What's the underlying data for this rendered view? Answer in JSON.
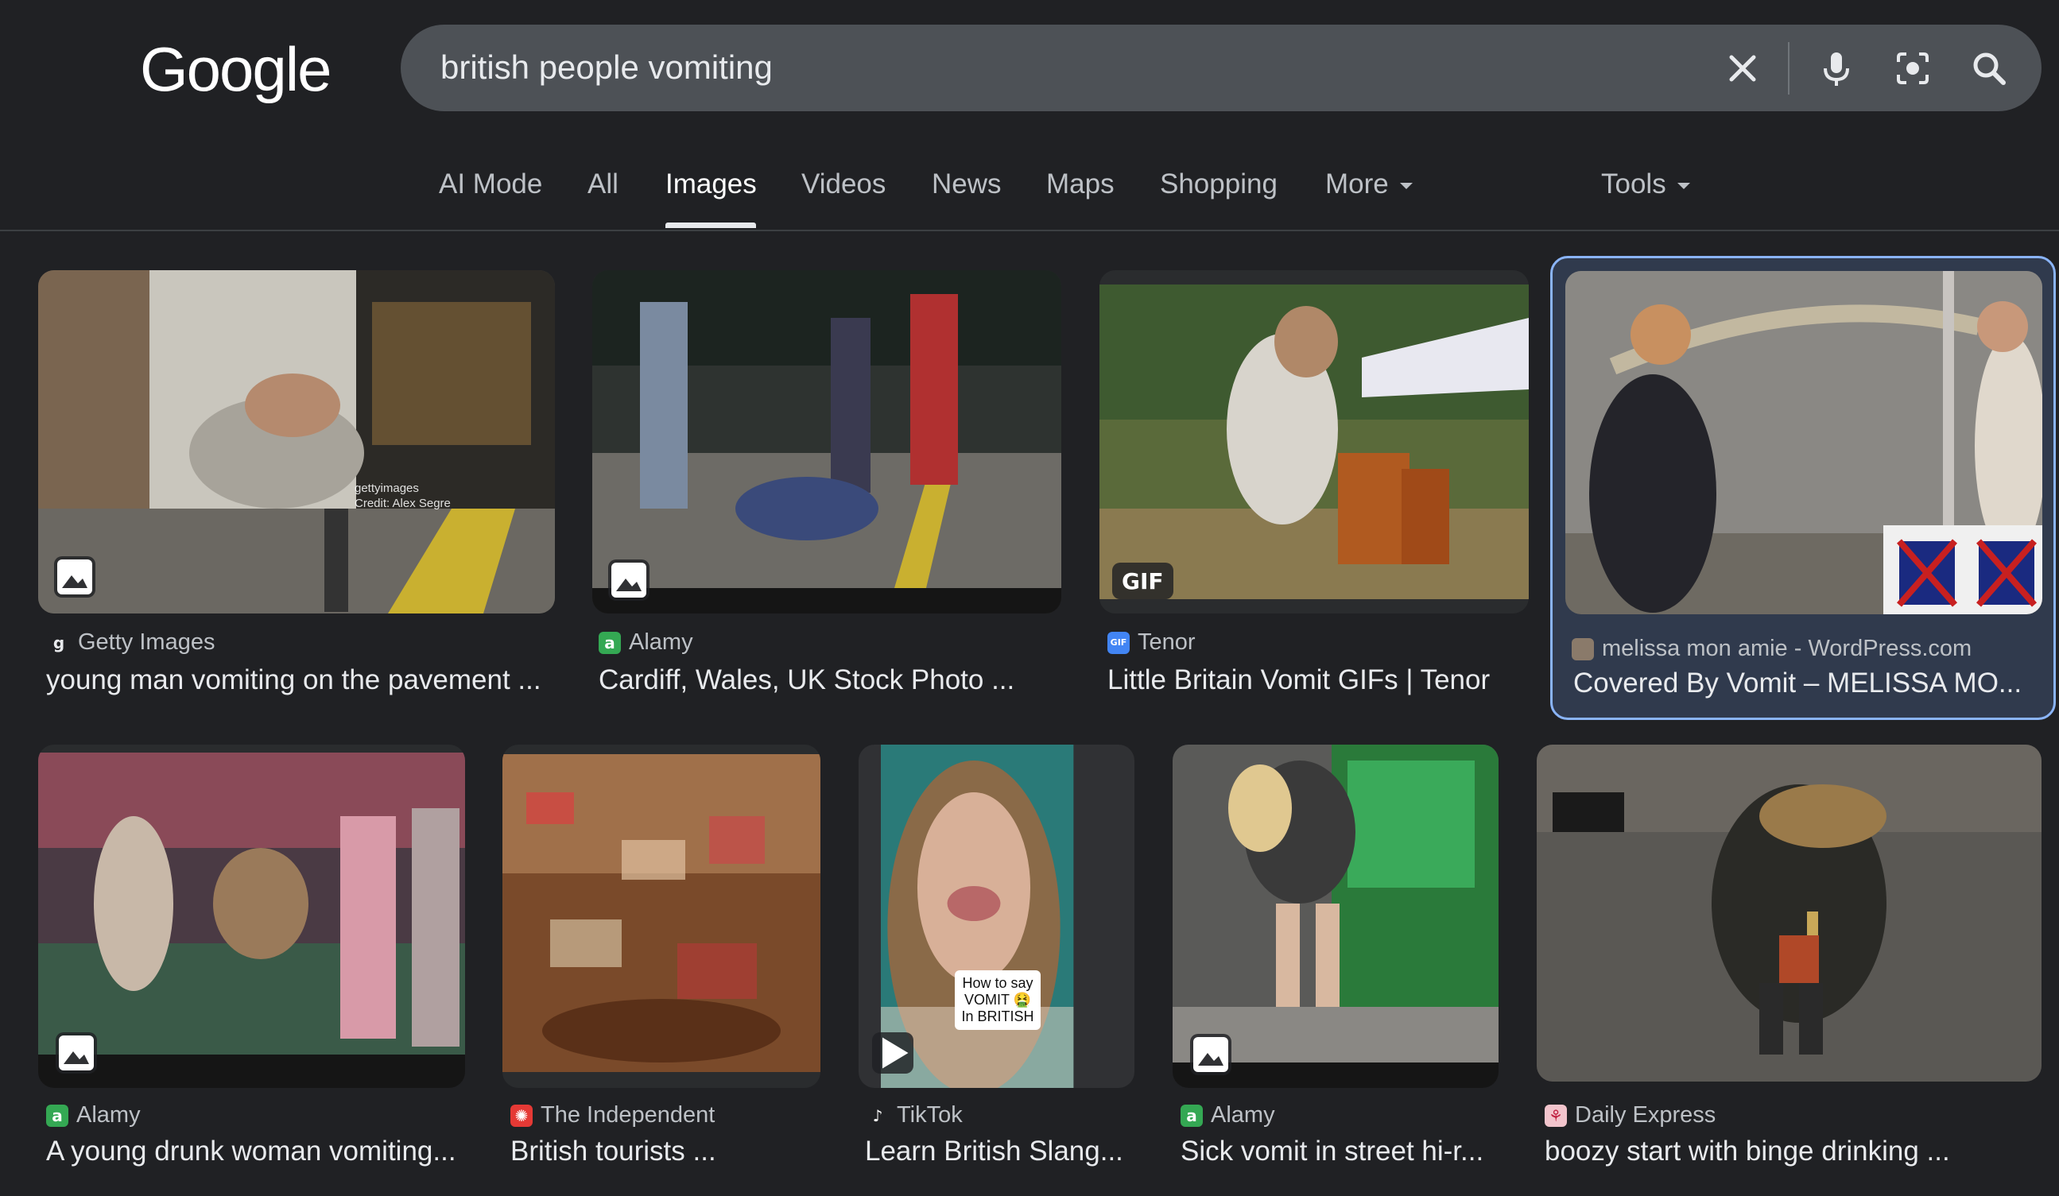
{
  "header": {
    "logo_text": "Google",
    "search_query": "british people vomiting"
  },
  "tabs": [
    {
      "label": "AI Mode"
    },
    {
      "label": "All"
    },
    {
      "label": "Images",
      "active": true
    },
    {
      "label": "Videos"
    },
    {
      "label": "News"
    },
    {
      "label": "Maps"
    },
    {
      "label": "Shopping"
    },
    {
      "label": "More"
    }
  ],
  "tools_label": "Tools",
  "results": [
    {
      "source": "Getty Images",
      "title": "young man vomiting on the pavement ...",
      "overlay": "gettyimages\nCredit: Alex Segre",
      "badge": "image-icon",
      "favicon_color": "#202124",
      "favicon_letter": "g"
    },
    {
      "source": "Alamy",
      "title": "Cardiff, Wales, UK Stock Photo ...",
      "badge": "image-icon",
      "favicon_color": "#34a853",
      "favicon_letter": "a"
    },
    {
      "source": "Tenor",
      "title": "Little Britain Vomit GIFs | Tenor",
      "badge_text": "GIF",
      "favicon_color": "#4285f4",
      "favicon_letter": "GIF"
    },
    {
      "source": "melissa mon amie - WordPress.com",
      "title": "Covered By Vomit – MELISSA MO...",
      "selected": true,
      "favicon_color": "#8a7a6a",
      "favicon_letter": ""
    },
    {
      "source": "Alamy",
      "title": "A young drunk woman vomiting...",
      "badge": "image-icon",
      "favicon_color": "#34a853",
      "favicon_letter": "a"
    },
    {
      "source": "The Independent",
      "title": "British tourists ...",
      "favicon_color": "#e53935",
      "favicon_letter": "✺"
    },
    {
      "source": "TikTok",
      "title": "Learn British Slang...",
      "badge": "play-icon",
      "caption": "How to say VOMIT 🤮 In BRITISH",
      "favicon_color": "#202124",
      "favicon_letter": "♪"
    },
    {
      "source": "Alamy",
      "title": "Sick vomit in street hi-r...",
      "badge": "image-icon",
      "favicon_color": "#34a853",
      "favicon_letter": "a"
    },
    {
      "source": "Daily Express",
      "title": "boozy start with binge drinking ...",
      "favicon_color": "#f2c4cc",
      "favicon_letter": "⚘"
    }
  ],
  "colors": {
    "background": "#202124",
    "searchbar": "#4d5156",
    "selected_border": "#8ab4f8"
  }
}
